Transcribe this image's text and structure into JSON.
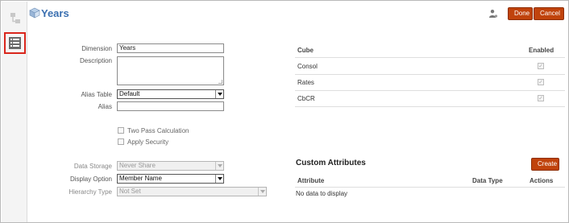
{
  "header": {
    "title": "Years",
    "done_label": "Done",
    "cancel_label": "Cancel"
  },
  "form": {
    "dimension": {
      "label": "Dimension",
      "value": "Years"
    },
    "description": {
      "label": "Description",
      "value": ""
    },
    "alias_table": {
      "label": "Alias Table",
      "value": "Default"
    },
    "alias": {
      "label": "Alias",
      "value": ""
    },
    "two_pass": {
      "label": "Two Pass Calculation",
      "checked": false
    },
    "apply_security": {
      "label": "Apply Security",
      "checked": false
    },
    "data_storage": {
      "label": "Data Storage",
      "value": "Never Share"
    },
    "display_option": {
      "label": "Display Option",
      "value": "Member Name"
    },
    "hierarchy_type": {
      "label": "Hierarchy Type",
      "value": "Not Set"
    }
  },
  "cube_table": {
    "columns": [
      "Cube",
      "Enabled"
    ],
    "rows": [
      {
        "cube": "Consol",
        "enabled": true
      },
      {
        "cube": "Rates",
        "enabled": true
      },
      {
        "cube": "CbCR",
        "enabled": true
      }
    ]
  },
  "custom_attributes": {
    "title": "Custom Attributes",
    "create_label": "Create",
    "columns": [
      "Attribute",
      "Data Type",
      "Actions"
    ],
    "empty_text": "No data to display"
  },
  "colors": {
    "accent": "#c0430c",
    "title": "#3a6fb0",
    "highlight_border": "#d9261c"
  },
  "icons": [
    "hierarchy-icon",
    "list-icon",
    "cube-icon",
    "user-icon"
  ]
}
